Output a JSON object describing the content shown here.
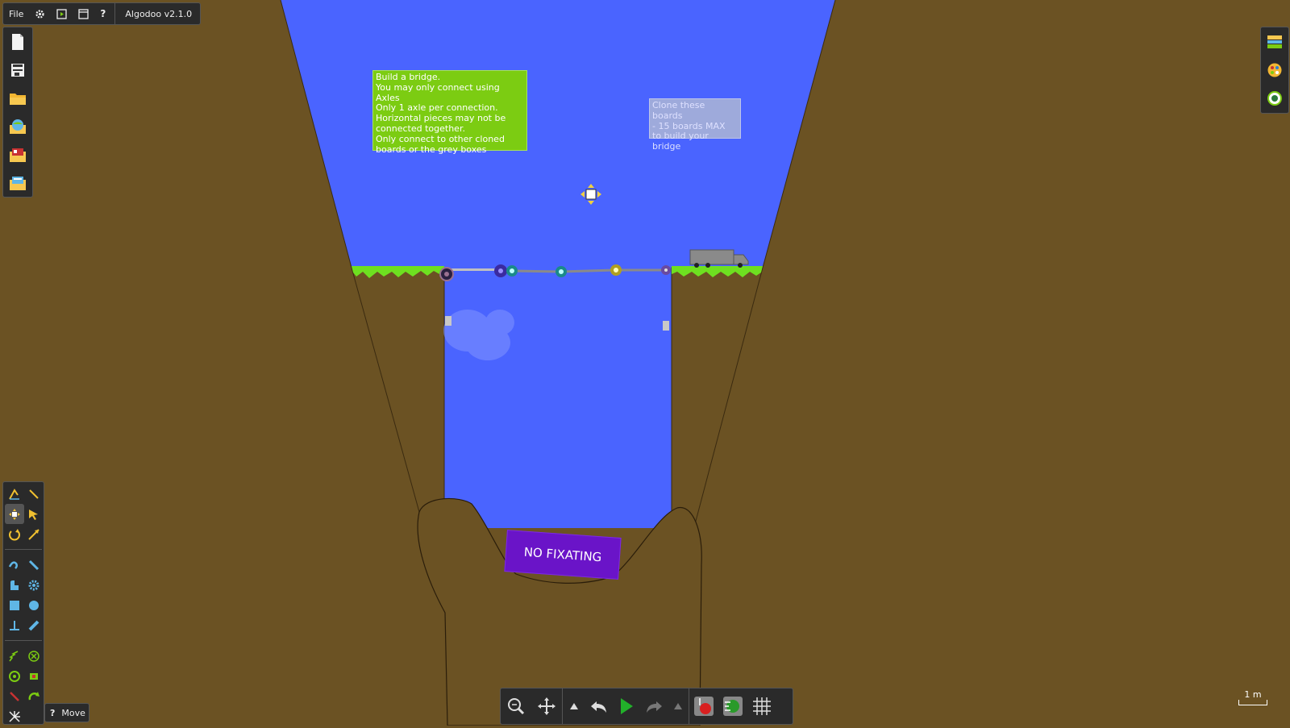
{
  "app": {
    "menu_file": "File",
    "version_label": "Algodoo v2.1.0"
  },
  "icons": {
    "top": [
      "gear-icon",
      "play-window-icon",
      "window-icon",
      "help-icon"
    ],
    "file_panel": [
      "new-scene-icon",
      "save-icon",
      "open-folder-icon",
      "browse-online-icon",
      "open-scene-icon",
      "open-recent-icon"
    ],
    "right_panel": [
      "background-icon",
      "palette-icon",
      "options-icon"
    ],
    "tools": [
      "sketch-tool-icon",
      "cut-tool-icon",
      "move-tool-icon",
      "drag-tool-icon",
      "rotate-tool-icon",
      "scale-tool-icon",
      "chain-tool-icon",
      "knife-tool-icon",
      "plane-tool-icon",
      "gear-tool-icon",
      "box-tool-icon",
      "circle-tool-icon",
      "fixate-tool-icon",
      "hinge-tool-icon",
      "spring-tool-icon",
      "axle-tool-icon",
      "thruster-tool-icon",
      "laser-tool-icon",
      "tracer-tool-icon",
      "brush-tool-icon",
      "pattern-tool-icon"
    ],
    "bottom": [
      "zoom-icon",
      "pan-icon",
      "speed-up-icon",
      "undo-icon",
      "play-icon",
      "redo-icon",
      "speed-down-icon",
      "gravity-icon",
      "air-friction-icon",
      "grid-icon"
    ]
  },
  "canvas": {
    "note_rules": "Build a bridge.\nYou may only connect using Axles\nOnly 1 axle per connection.\nHorizontal pieces may not be\nconnected together.\nOnly connect to other cloned\nboards or the grey boxes",
    "note_clone": "Clone these boards\n- 15 boards MAX\nto build your bridge",
    "sign_text": "NO FIXATING",
    "scale_label": "1 m"
  },
  "status": {
    "help_symbol": "?",
    "current_tool": "Move"
  },
  "colors": {
    "sky": "#4a64ff",
    "dirt": "#6b5223",
    "grass": "#6ee020",
    "note_green": "#7ccc12",
    "sign_purple": "#6a14c8",
    "ui_panel": "#2a2a2a"
  }
}
